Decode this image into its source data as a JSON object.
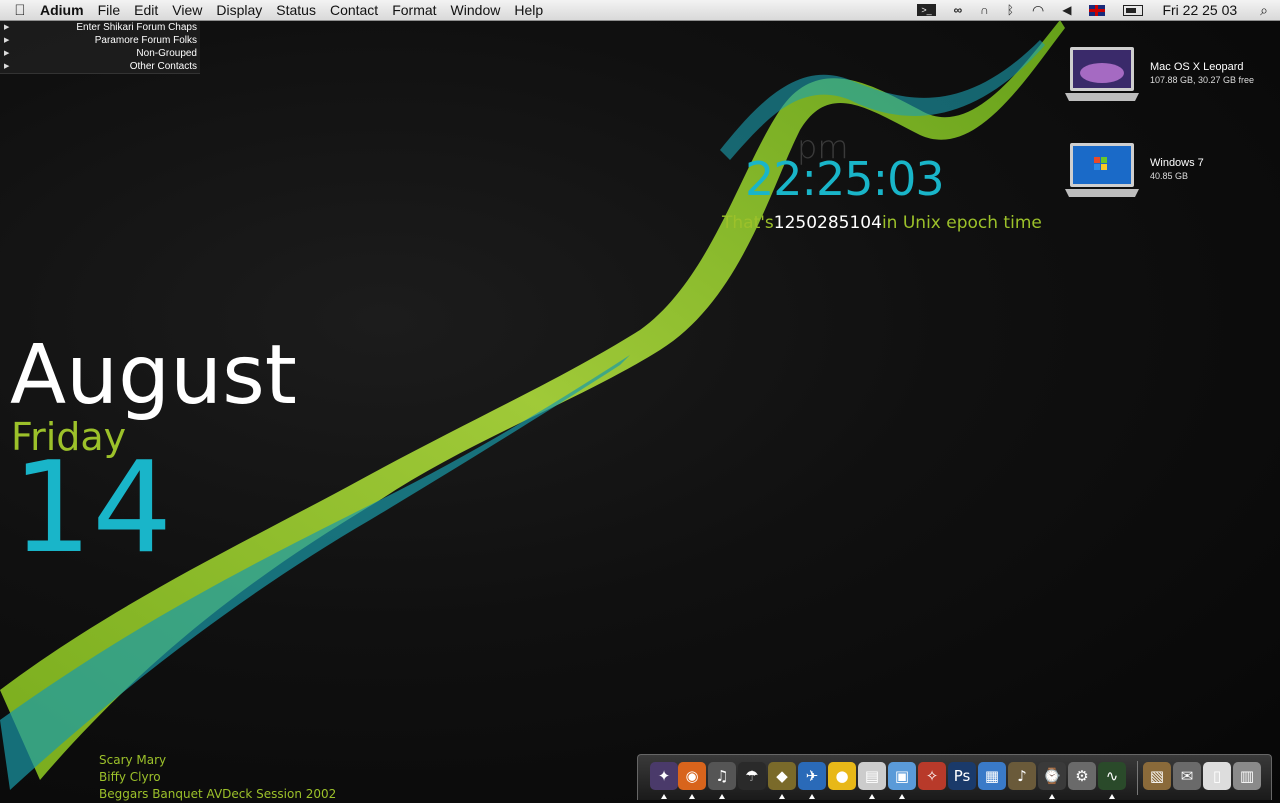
{
  "menubar": {
    "app_name": "Adium",
    "items": [
      "File",
      "Edit",
      "View",
      "Display",
      "Status",
      "Contact",
      "Format",
      "Window",
      "Help"
    ],
    "status_icons": [
      "terminal-icon",
      "lastfm-icon",
      "headphones-icon",
      "bluetooth-icon",
      "wifi-icon",
      "volume-icon",
      "uk-flag-icon",
      "battery-icon"
    ],
    "clock": "Fri 22 25 03"
  },
  "contacts": {
    "groups": [
      "Enter Shikari Forum Chaps",
      "Paramore Forum Folks",
      "Non-Grouped",
      "Other Contacts"
    ]
  },
  "clock_widget": {
    "ampm": "pm",
    "time": "22:25:03",
    "epoch_prefix": "That's",
    "epoch_value": "1250285104",
    "epoch_suffix": "in Unix epoch time"
  },
  "date_widget": {
    "month": "August",
    "weekday": "Friday",
    "day": "14"
  },
  "drives": [
    {
      "name": "Mac OS X Leopard",
      "size": "107.88 GB, 30.27 GB free"
    },
    {
      "name": "Windows 7",
      "size": "40.85 GB"
    }
  ],
  "now_playing": {
    "title": "Scary Mary",
    "artist": "Biffy Clyro",
    "album": "Beggars Banquet AVDeck Session 2002"
  },
  "dock": {
    "items": [
      {
        "name": "launcher-icon",
        "glyph": "✦",
        "color": "#4a3a6a",
        "running": true
      },
      {
        "name": "firefox-icon",
        "glyph": "◉",
        "color": "#d8641c",
        "running": true
      },
      {
        "name": "itunes-icon",
        "glyph": "♫",
        "color": "#555555",
        "running": true
      },
      {
        "name": "camino-icon",
        "glyph": "☂",
        "color": "#2a2a2a",
        "running": false
      },
      {
        "name": "adium-icon",
        "glyph": "◆",
        "color": "#7a6a2a",
        "running": true
      },
      {
        "name": "twitter-bird-icon",
        "glyph": "✈",
        "color": "#2a6ab8",
        "running": true
      },
      {
        "name": "duck-icon",
        "glyph": "●",
        "color": "#e8b818",
        "running": false
      },
      {
        "name": "newspaper-icon",
        "glyph": "▤",
        "color": "#cccccc",
        "running": true
      },
      {
        "name": "preview-icon",
        "glyph": "▣",
        "color": "#5a9ad8",
        "running": true
      },
      {
        "name": "transmit-icon",
        "glyph": "✧",
        "color": "#b83a2a",
        "running": false
      },
      {
        "name": "photoshop-icon",
        "glyph": "Ps",
        "color": "#1a3a6a",
        "running": false
      },
      {
        "name": "calendar-icon",
        "glyph": "▦",
        "color": "#3a7ac8",
        "running": false
      },
      {
        "name": "guitar-icon",
        "glyph": "♪",
        "color": "#6a5a3a",
        "running": false
      },
      {
        "name": "time-machine-icon",
        "glyph": "⌚",
        "color": "#3a3a3a",
        "running": true
      },
      {
        "name": "system-preferences-icon",
        "glyph": "⚙",
        "color": "#6a6a6a",
        "running": false
      },
      {
        "name": "activity-monitor-icon",
        "glyph": "∿",
        "color": "#2a4a2a",
        "running": true
      },
      {
        "name": "documents-stack-icon",
        "glyph": "▧",
        "color": "#8a6a3a",
        "running": false
      },
      {
        "name": "mail-icon",
        "glyph": "✉",
        "color": "#6a6a6a",
        "running": false
      },
      {
        "name": "downloads-stack-icon",
        "glyph": "▯",
        "color": "#dddddd",
        "running": false
      },
      {
        "name": "trash-icon",
        "glyph": "▥",
        "color": "#8a8a8a",
        "running": false
      }
    ]
  },
  "colors": {
    "accent_cyan": "#19b5c9",
    "accent_green": "#9cc12a"
  }
}
